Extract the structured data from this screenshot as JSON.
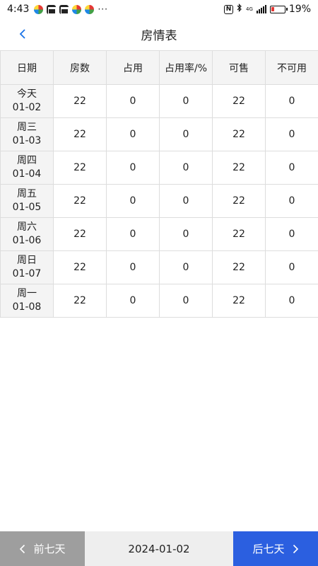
{
  "status_bar": {
    "time": "4:43",
    "dots": "···",
    "network": "4G",
    "battery_pct": "19%",
    "icons": [
      "round-app-icon",
      "mail-icon",
      "mail-icon",
      "round-app-icon",
      "round-app-icon",
      "nfc-icon",
      "bluetooth-icon",
      "signal-icon",
      "battery-icon"
    ]
  },
  "header": {
    "title": "房情表",
    "back_icon": "chevron-left-icon",
    "accent": "#1a73e8"
  },
  "table": {
    "columns": [
      "日期",
      "房数",
      "占用",
      "占用率/%",
      "可售",
      "不可用"
    ],
    "rows": [
      {
        "day": "今天",
        "date": "01-02",
        "rooms": "22",
        "occupied": "0",
        "rate": "0",
        "available": "22",
        "unavailable": "0"
      },
      {
        "day": "周三",
        "date": "01-03",
        "rooms": "22",
        "occupied": "0",
        "rate": "0",
        "available": "22",
        "unavailable": "0"
      },
      {
        "day": "周四",
        "date": "01-04",
        "rooms": "22",
        "occupied": "0",
        "rate": "0",
        "available": "22",
        "unavailable": "0"
      },
      {
        "day": "周五",
        "date": "01-05",
        "rooms": "22",
        "occupied": "0",
        "rate": "0",
        "available": "22",
        "unavailable": "0"
      },
      {
        "day": "周六",
        "date": "01-06",
        "rooms": "22",
        "occupied": "0",
        "rate": "0",
        "available": "22",
        "unavailable": "0"
      },
      {
        "day": "周日",
        "date": "01-07",
        "rooms": "22",
        "occupied": "0",
        "rate": "0",
        "available": "22",
        "unavailable": "0"
      },
      {
        "day": "周一",
        "date": "01-08",
        "rooms": "22",
        "occupied": "0",
        "rate": "0",
        "available": "22",
        "unavailable": "0"
      }
    ]
  },
  "bottom_bar": {
    "prev_label": "前七天",
    "current_date": "2024-01-02",
    "next_label": "后七天",
    "prev_color": "#9e9e9e",
    "next_color": "#2b5fe0"
  }
}
